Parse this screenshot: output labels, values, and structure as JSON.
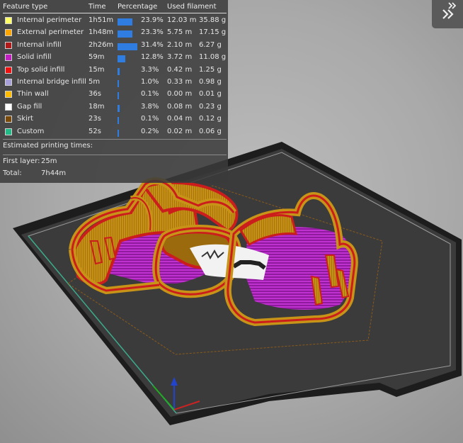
{
  "legend": {
    "headers": {
      "feature_type": "Feature type",
      "time": "Time",
      "percentage": "Percentage",
      "used_filament": "Used filament"
    },
    "rows": [
      {
        "name": "Internal perimeter",
        "color": "#ffff66",
        "time": "1h51m",
        "percent": "23.9%",
        "percent_value": 23.9,
        "length": "12.03 m",
        "weight": "35.88 g"
      },
      {
        "name": "External perimeter",
        "color": "#ffa500",
        "time": "1h48m",
        "percent": "23.3%",
        "percent_value": 23.3,
        "length": "5.75 m",
        "weight": "17.15 g"
      },
      {
        "name": "Internal infill",
        "color": "#b01a1a",
        "time": "2h26m",
        "percent": "31.4%",
        "percent_value": 31.4,
        "length": "2.10 m",
        "weight": "6.27 g"
      },
      {
        "name": "Solid infill",
        "color": "#c020c0",
        "time": "59m",
        "percent": "12.8%",
        "percent_value": 12.8,
        "length": "3.72 m",
        "weight": "11.08 g"
      },
      {
        "name": "Top solid infill",
        "color": "#ee1111",
        "time": "15m",
        "percent": "3.3%",
        "percent_value": 3.3,
        "length": "0.42 m",
        "weight": "1.25 g"
      },
      {
        "name": "Internal bridge infill",
        "color": "#a8a0d8",
        "time": "5m",
        "percent": "1.0%",
        "percent_value": 1.0,
        "length": "0.33 m",
        "weight": "0.98 g"
      },
      {
        "name": "Thin wall",
        "color": "#ffbb00",
        "time": "36s",
        "percent": "0.1%",
        "percent_value": 0.1,
        "length": "0.00 m",
        "weight": "0.01 g"
      },
      {
        "name": "Gap fill",
        "color": "#ffffff",
        "time": "18m",
        "percent": "3.8%",
        "percent_value": 3.8,
        "length": "0.08 m",
        "weight": "0.23 g"
      },
      {
        "name": "Skirt",
        "color": "#7a4a0a",
        "time": "23s",
        "percent": "0.1%",
        "percent_value": 0.1,
        "length": "0.04 m",
        "weight": "0.12 g"
      },
      {
        "name": "Custom",
        "color": "#22bb88",
        "time": "52s",
        "percent": "0.2%",
        "percent_value": 0.2,
        "length": "0.02 m",
        "weight": "0.06 g"
      }
    ],
    "estimated_title": "Estimated printing times:",
    "first_layer_label": "First layer:",
    "first_layer_value": "25m",
    "total_label": "Total:",
    "total_value": "7h44m"
  },
  "collapse_button": {
    "icon": "double-chevron-right-icon"
  },
  "scene": {
    "bed_color": "#3a3a3a",
    "perimeter_color": "#c79418",
    "top_edge_color": "#cc1d1d",
    "infill_color": "#b22bc0",
    "axis_colors": {
      "x": "#cc2222",
      "y": "#22aa22",
      "z": "#2244cc"
    }
  }
}
